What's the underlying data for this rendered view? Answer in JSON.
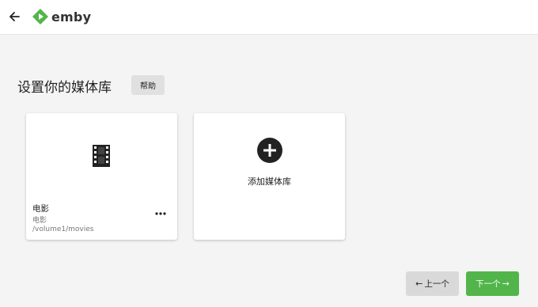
{
  "header": {
    "brand": "emby",
    "brand_color": "#52b54b"
  },
  "main": {
    "title": "设置你的媒体库",
    "help_label": "帮助",
    "libraries": [
      {
        "name": "电影",
        "type": "电影",
        "path": "/volume1/movies",
        "icon": "film-icon"
      }
    ],
    "add_library_label": "添加媒体库"
  },
  "footer": {
    "prev_label": "上一个",
    "next_label": "下一个",
    "next_color": "#52b54b"
  }
}
